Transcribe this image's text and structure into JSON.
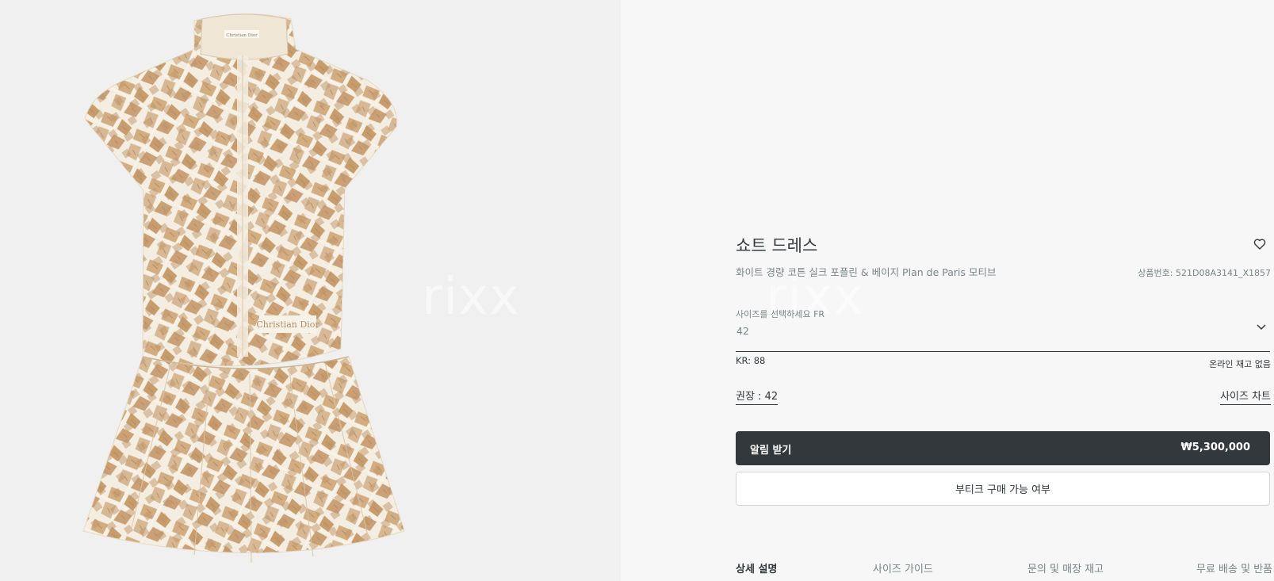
{
  "product": {
    "image_alt_icon": "dress-image",
    "watermark": "rixx",
    "title": "쇼트 드레스",
    "subtitle": "화이트 경량 코튼 실크 포플린 & 베이지 Plan de Paris 모티브",
    "sku": "상품번호: 521D08A3141_X1857",
    "neck_label": "Christian Dior",
    "hip_label": "Christian Dior"
  },
  "size": {
    "label": "사이즈를 선택하세요 FR",
    "value": "42",
    "kr": "KR: 88",
    "stock": "온라인 재고 없음",
    "recommend": "권장 : 42",
    "chart_link": "사이즈 차트"
  },
  "actions": {
    "notify_label": "알림 받기",
    "price": "₩5,300,000",
    "boutique_label": "부티크 구매 가능 여부"
  },
  "tabs": [
    "상세 설명",
    "사이즈 가이드",
    "문의 및 매장 재고",
    "무료 배송 및 반품"
  ],
  "colors": {
    "primary_dark": "#33383c",
    "muted_text": "#7b8487",
    "fabric_base": "#f4eee2",
    "print_beige": "#c29a6b"
  }
}
